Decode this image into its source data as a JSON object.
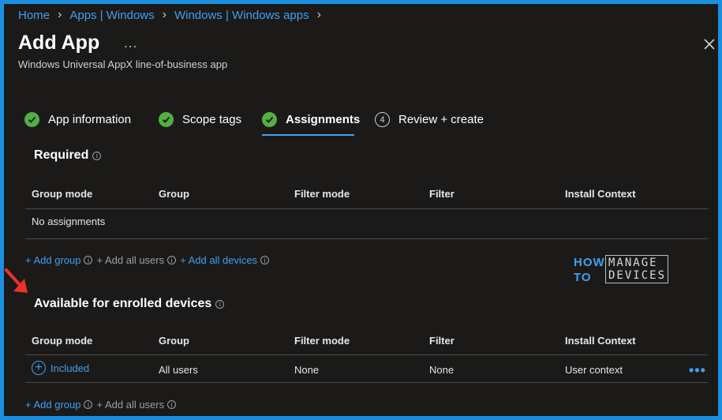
{
  "breadcrumb": [
    "Home",
    "Apps | Windows",
    "Windows | Windows apps"
  ],
  "header": {
    "title": "Add App",
    "more": "...",
    "subtitle": "Windows Universal AppX line-of-business app"
  },
  "steps": [
    {
      "label": "App information",
      "state": "done"
    },
    {
      "label": "Scope tags",
      "state": "done"
    },
    {
      "label": "Assignments",
      "state": "active"
    },
    {
      "label": "Review + create",
      "state": "pending",
      "number": "4"
    }
  ],
  "required": {
    "title": "Required",
    "columns": [
      "Group mode",
      "Group",
      "Filter mode",
      "Filter",
      "Install Context"
    ],
    "empty_text": "No assignments",
    "actions": {
      "add_group": "+ Add group",
      "add_all_users": "+ Add all users",
      "add_all_devices": "+ Add all devices"
    }
  },
  "available": {
    "title": "Available for enrolled devices",
    "columns": [
      "Group mode",
      "Group",
      "Filter mode",
      "Filter",
      "Install Context"
    ],
    "rows": [
      {
        "group_mode": "Included",
        "group": "All users",
        "filter_mode": "None",
        "filter": "None",
        "install_context": "User context",
        "more": "•••"
      }
    ],
    "actions": {
      "add_group": "+ Add group",
      "add_all_users": "+ Add all users"
    }
  },
  "watermark": {
    "how": "HOW",
    "to": "TO",
    "manage": "MANAGE",
    "devices": "DEVICES"
  },
  "colors": {
    "accent": "#3fa0f0",
    "success": "#52b043",
    "background": "#1b1a19",
    "frame": "#1a8fe0",
    "arrow": "#e8322b"
  }
}
